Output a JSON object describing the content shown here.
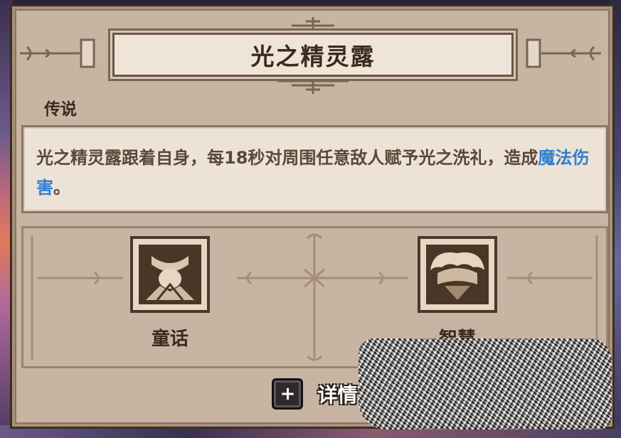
{
  "item": {
    "title": "光之精灵露",
    "rarity": "传说",
    "description_part1": "光之精灵露跟着自身，每18秒对周围任意敌人赋予光之洗礼，造成",
    "description_keyword": "魔法伤害",
    "description_part2": "。"
  },
  "traits": [
    {
      "label": "童话",
      "icon": "fairy-tale-icon"
    },
    {
      "label": "智慧",
      "icon": "wisdom-icon"
    }
  ],
  "details_button": {
    "label": "详情",
    "icon": "plus-icon"
  },
  "colors": {
    "panel_bg": "#c8b4a2",
    "banner_bg": "#efe4d8",
    "text_dark": "#3b2a1e",
    "keyword_blue": "#2f7fd0",
    "icon_frame": "#3a2a1e"
  }
}
